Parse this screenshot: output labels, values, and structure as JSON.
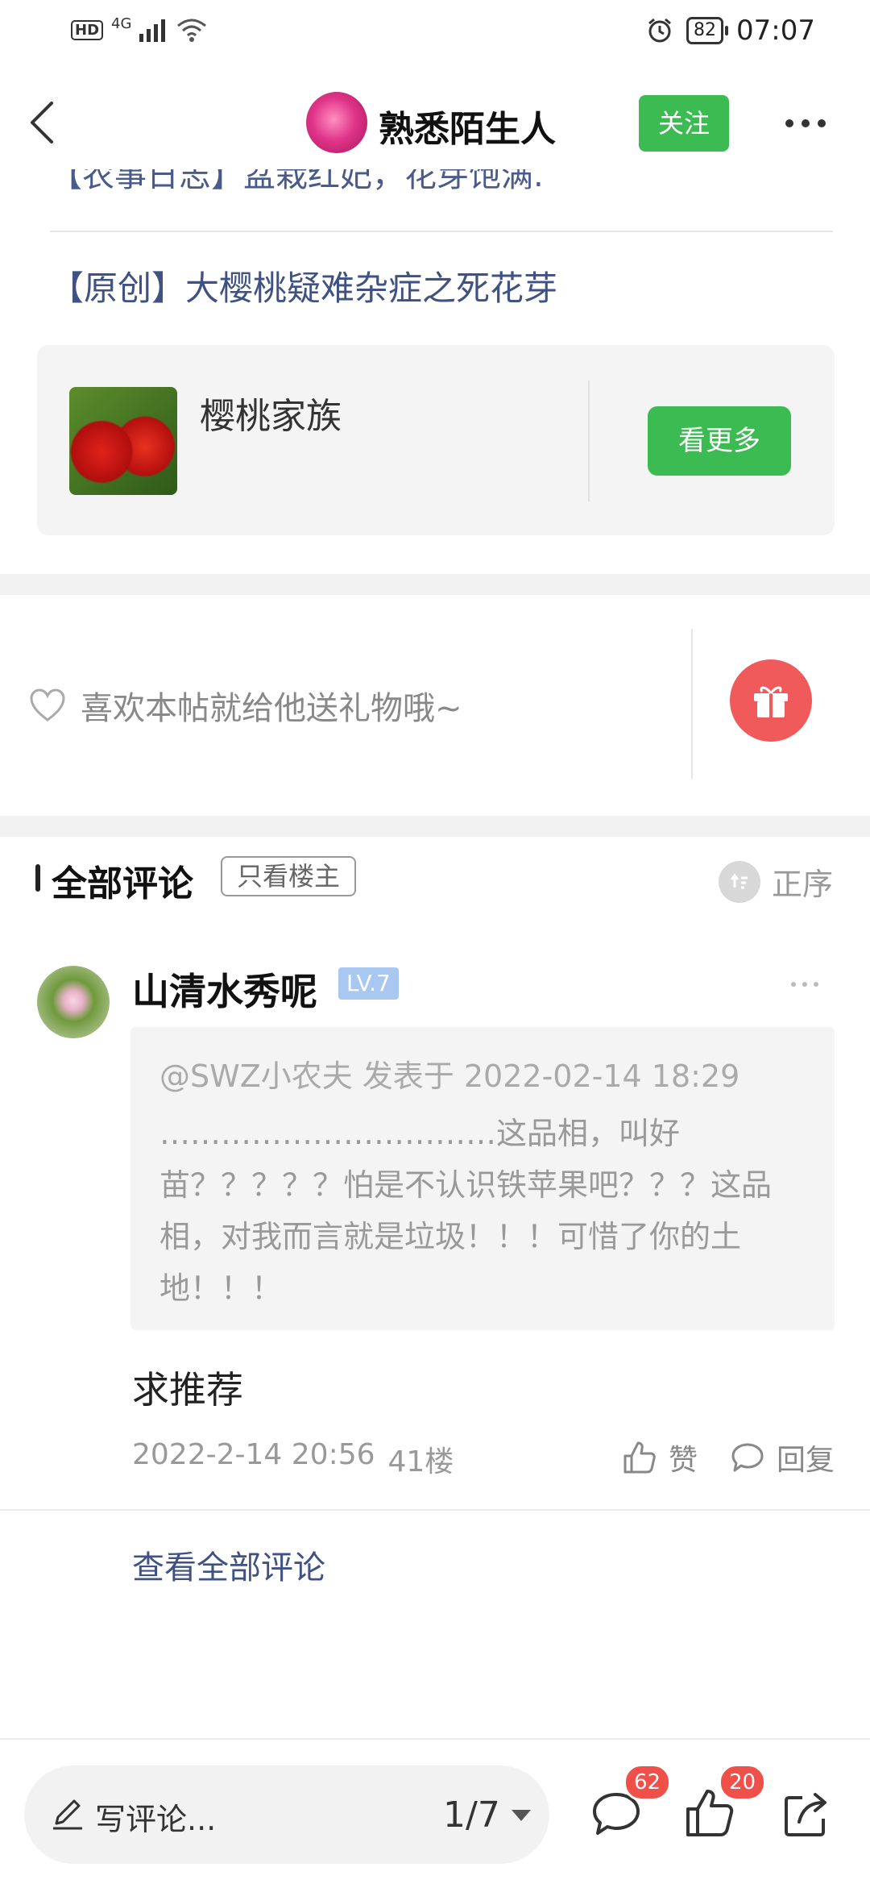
{
  "status_bar": {
    "hd": "HD",
    "network": "4G",
    "battery": "82",
    "time": "07:07"
  },
  "header": {
    "author_name": "熟悉陌生人",
    "follow_label": "关注"
  },
  "post": {
    "cut_link_text": "【农事日志】盆栽红妃，花芽饱满.",
    "original_link_text": "【原创】大樱桃疑难杂症之死花芽"
  },
  "forum_card": {
    "name": "樱桃家族",
    "see_more_label": "看更多"
  },
  "gift": {
    "prompt": "喜欢本帖就给他送礼物哦~"
  },
  "comments_header": {
    "title": "全部评论",
    "only_owner_label": "只看楼主",
    "order_label": "正序"
  },
  "comment": {
    "username": "山清水秀呢",
    "level": "LV.7",
    "quote_header": "@SWZ小农夫 发表于 2022-02-14 18:29",
    "quote_body": "……………………………这品相，叫好苗？？？？？怕是不认识铁苹果吧？？？这品相，对我而言就是垃圾！！！可惜了你的土地！！！",
    "text": "求推荐",
    "date": "2022-2-14 20:56",
    "floor": "41楼",
    "like_label": "赞",
    "reply_label": "回复"
  },
  "view_all_comments": "查看全部评论",
  "bottom_bar": {
    "write_placeholder": "写评论...",
    "page_indicator": "1/7",
    "comment_count": "62",
    "like_count": "20"
  },
  "colors": {
    "accent_green": "#3dbb53",
    "link_blue": "#3f5283",
    "badge_red": "#f0504a",
    "gift_red": "#f05a5a"
  }
}
